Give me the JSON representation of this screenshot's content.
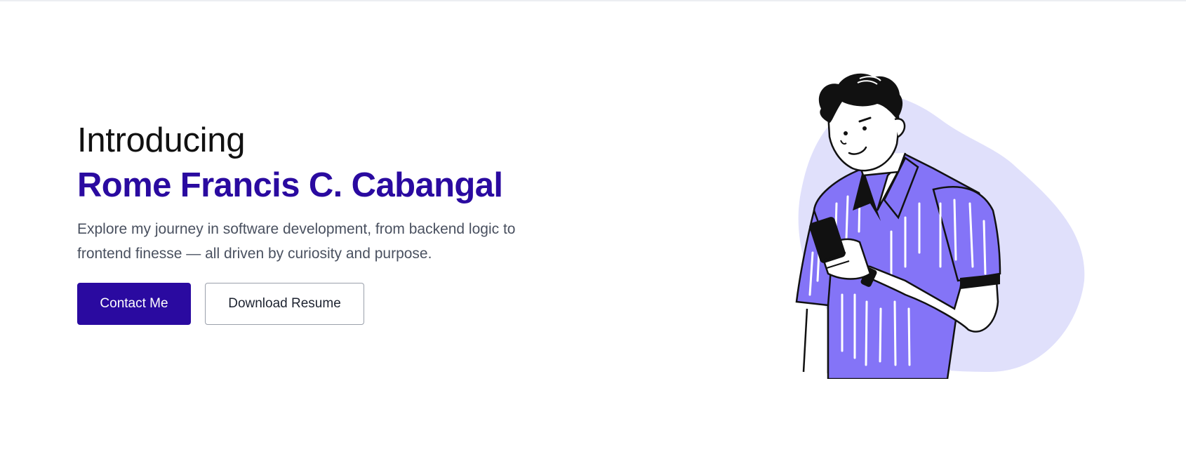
{
  "hero": {
    "intro_word": "Introducing",
    "name": "Rome Francis C. Cabangal",
    "tagline": "Explore my journey in software development, from backend logic to frontend finesse — all driven by curiosity and purpose.",
    "contact_label": "Contact Me",
    "resume_label": "Download Resume"
  },
  "colors": {
    "brand": "#2a0aa0",
    "blob": "#e0e0fb",
    "shirt": "#8474f7"
  },
  "illustration": {
    "icon": "person-with-phone-illustration"
  }
}
